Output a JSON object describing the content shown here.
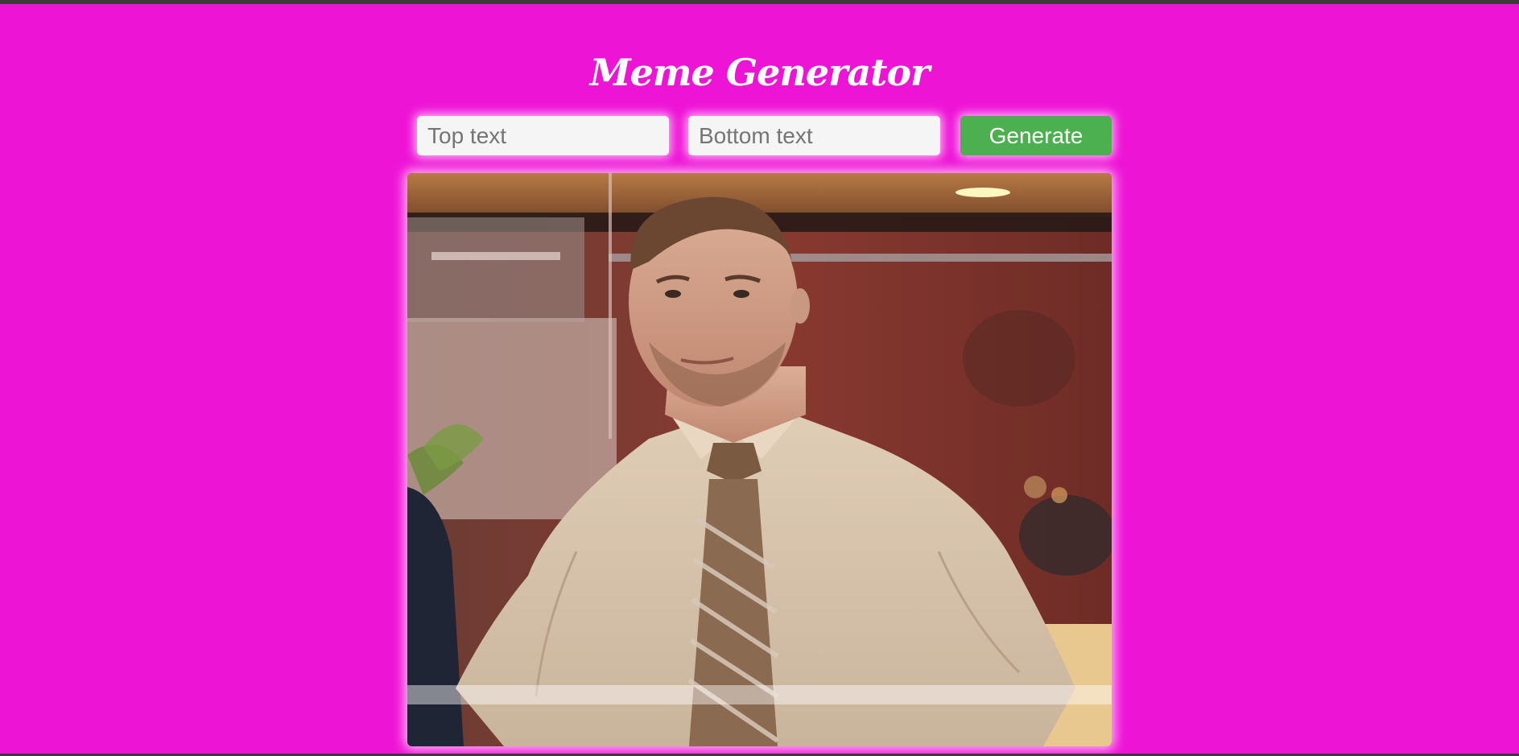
{
  "app": {
    "title": "Meme Generator"
  },
  "form": {
    "top_text": {
      "value": "",
      "placeholder": "Top text"
    },
    "bottom_text": {
      "value": "",
      "placeholder": "Bottom text"
    },
    "generate_label": "Generate"
  },
  "colors": {
    "background": "#ee14d6",
    "button": "#4caf50",
    "field": "#f5f5f5",
    "title": "#ffffff"
  },
  "meme": {
    "image": "man-in-tie-office-photo"
  }
}
